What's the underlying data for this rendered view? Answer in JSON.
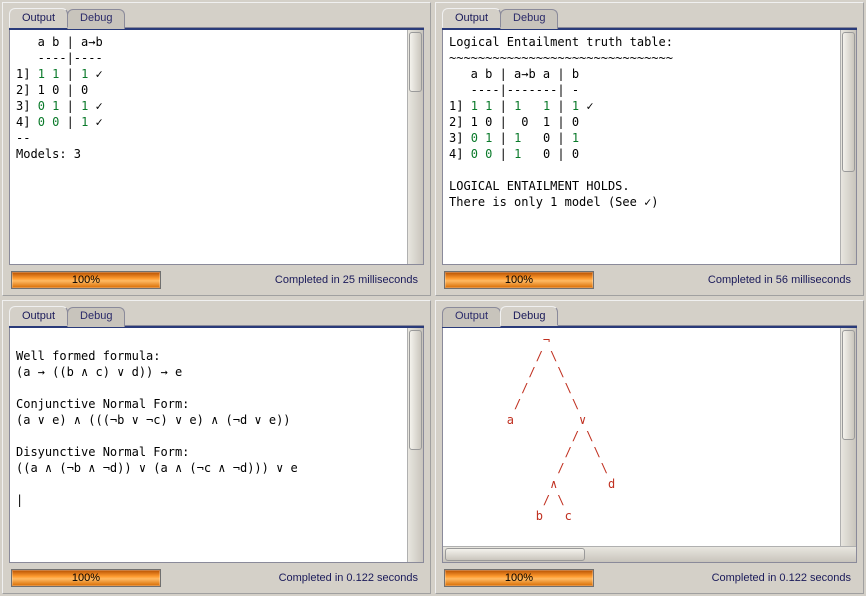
{
  "tabs": {
    "output": "Output",
    "debug": "Debug"
  },
  "panels": {
    "tl": {
      "lines": [
        {
          "pre": "   a b | a→b"
        },
        {
          "pre": "   ----|----"
        },
        {
          "pre": "1] ",
          "tk": "1 1",
          " mid": " | ",
          "tk2": "1",
          " post": " ✓"
        },
        {
          "pre": "2] 1 0 | 0"
        },
        {
          "pre": "3] ",
          "tk": "0 1",
          " mid": " | ",
          "tk2": "1",
          " post": " ✓"
        },
        {
          "pre": "4] ",
          "tk": "0 0",
          " mid": " | ",
          "tk2": "1",
          " post": " ✓"
        },
        {
          "pre": "--"
        },
        {
          "pre": "Models: 3"
        }
      ],
      "status": "Completed in 25 milliseconds",
      "progress": "100%"
    },
    "tr": {
      "lines": [
        {
          "pre": "Logical Entailment truth table:"
        },
        {
          "pre": "~~~~~~~~~~~~~~~~~~~~~~~~~~~~~~~"
        },
        {
          "pre": "   a b | a→b a | b"
        },
        {
          "pre": "   ----|-------| -"
        },
        {
          "pre": "1] ",
          "tk": "1 1",
          " mid": " | ",
          "tk2": "1   1",
          " mid2": " | ",
          "tk3": "1",
          " post": " ✓"
        },
        {
          "pre": "2] 1 0 |  0  1 | 0"
        },
        {
          "pre": "3] ",
          "tk": "0 1",
          " mid": " | ",
          "tk2": "1",
          " mid2": "   0 | ",
          "tk3": "1"
        },
        {
          "pre": "4] ",
          "tk": "0 0",
          " mid": " | ",
          "tk2": "1",
          " mid2": "   0 | 0"
        },
        {
          "pre": ""
        },
        {
          "pre": "LOGICAL ENTAILMENT HOLDS."
        },
        {
          "pre": "There is only 1 model (See ✓)"
        }
      ],
      "status": "Completed in 56 milliseconds",
      "progress": "100%"
    },
    "bl": {
      "lines": [
        {
          "pre": ""
        },
        {
          "pre": "Well formed formula:"
        },
        {
          "pre": "(a → ((b ∧ c) ∨ d)) → e"
        },
        {
          "pre": ""
        },
        {
          "pre": "Conjunctive Normal Form:"
        },
        {
          "pre": "(a ∨ e) ∧ (((¬b ∨ ¬c) ∨ e) ∧ (¬d ∨ e))"
        },
        {
          "pre": ""
        },
        {
          "pre": "Disyunctive Normal Form:"
        },
        {
          "pre": "((a ∧ (¬b ∧ ¬d)) ∨ (a ∧ (¬c ∧ ¬d))) ∨ e"
        },
        {
          "pre": ""
        },
        {
          "pre": "|"
        }
      ],
      "status": "Completed in 0.122 seconds",
      "progress": "100%"
    },
    "br": {
      "tree": "             ¬\n            / \\\n           /   \\\n          /     \\\n         /       \\\n        a         ∨\n                 / \\\n                /   \\\n               /     \\\n              ∧       d\n             / \\\n            b   c",
      "status": "Completed in 0.122 seconds",
      "progress": "100%"
    }
  }
}
